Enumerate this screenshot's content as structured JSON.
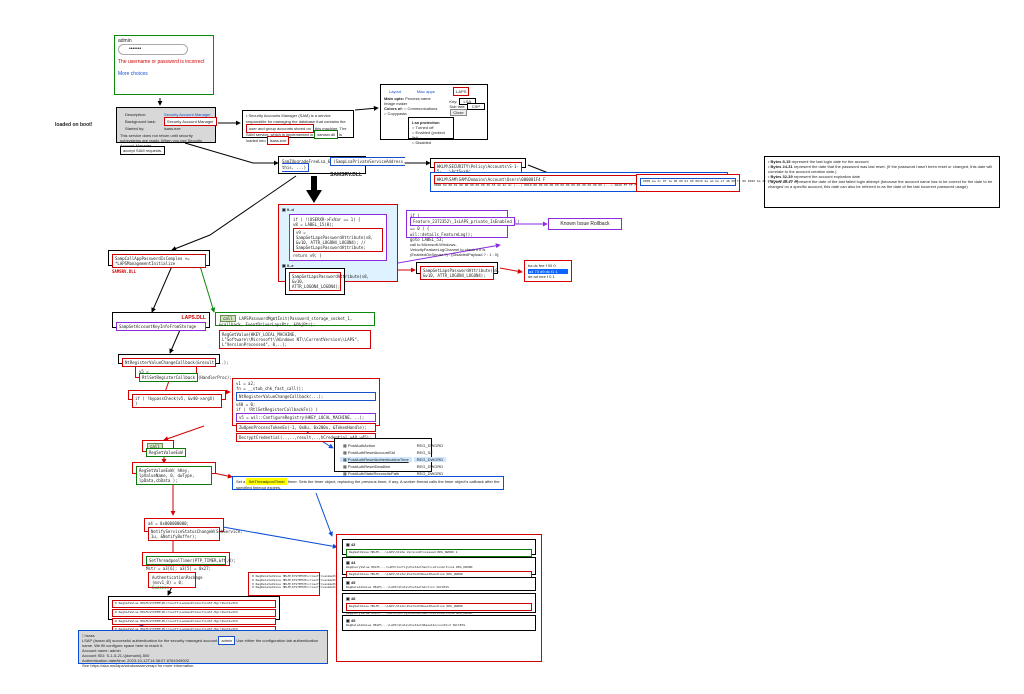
{
  "labels": {
    "loaded_on_boot": "loaded on boot!",
    "samsrv_dll": "SAMSRV.DLL",
    "laps_dll": "LAPS.DLL",
    "kir": "Known Issue Rollback"
  },
  "login": {
    "user": "admin",
    "warn": "The username or password is incorrect",
    "more": "More choices"
  },
  "svc": {
    "k1": "Description:",
    "k2": "Background task:",
    "v2": "Security Account Manager",
    "k3": "Started by:",
    "v3": "lsass.exe"
  },
  "svc_card": {
    "title": "Security Account Manager",
    "body": "This service does not return until security subsystems are ready. When you use Security Account Manager",
    "tail": "interfaces, use this service to ensure the server is ready to",
    "redtail": "accept SAM requests."
  },
  "sam_desc": {
    "a": "Security Accounts Manager (SAM) is a service responsible for managing the database that contains the",
    "b": "user and group accounts stored on",
    "c": " this machine. The SAM service, which is implemented in",
    "d": " is loaded into",
    "e": " at boot time."
  },
  "procexp": {
    "layout": "Layout",
    "misc_apps": "Misc apps",
    "laps": "LAPS",
    "main_opts": "Main opts:",
    "o1": "Process name",
    "o2": "Image maker",
    "colors": "Colors of:",
    "o3": "Communications",
    "o4": "Copypasta",
    "lsasection": "Lsa protection",
    "opt1": "Turned off",
    "opt2": "Enabled (protect list)",
    "opt3": "Disabled",
    "l1": "Key:",
    "v1": "LSA",
    "l2": "Sub tree:",
    "v2": "CSP",
    "close": "Close"
  },
  "samr": {
    "sig": "SamIUpgradeFreeLsa_6",
    "arg": "(SampLsaPrivateServiceAddress, this, ...)",
    "text": "SAMSRV.DLL"
  },
  "sampcalls": {
    "top": "SampCallAppPasswordIsComplex += *LAPSManagementInitialize",
    "bottom": "SampCallAppPasswordIsComplex",
    "next": "SampGetAccountKeyInfoFromStorage"
  },
  "feat": {
    "fn": "Feature_2372352\\_IsLAPS_private_IsEnabled",
    "ret": "() == 0 ) {",
    "l1": "wil::details_FeatureLog();",
    "l2": "goto LABEL_53;",
    "note": "call to Microsoft-Windows-VelocityFeatureLogChannel to check if it is (EnabledOnServer ?) : (DisabledPayload ? : 1 : 0);"
  },
  "codeblock1": {
    "l1": "if ( !(USERXR->FxVar == 1) {",
    "l2": "v8 = LABEL_15(0);",
    "l3": "v9 = SampGetLapsPasswordAttribute(v8, &v10, ATTR_LOGON4_LOGON4); // SampGetLapsPasswordAttribute;",
    "l4": "return v9; }"
  },
  "codeblock2": {
    "fn": "SampGetLapsPasswordAttribute(v8, &v10, ATTR_LOGON4_LOGON4);"
  },
  "laps_init": {
    "call": "LAPSPasswordMgmtInit(Password_storage_socket_1, &callback, EventDriverLapsPtr, &ObjPtr);",
    "reg": "RegGetValue(HKEY_LOCAL_MACHINE, L\"Software\\\\Microsoft\\\\Windows NT\\\\CurrentVersion\\\\LAPS\", L\"VersionProcessed\", 0,..);"
  },
  "bytes": {
    "b1h": "Bytes 8-15",
    "b1t": " represent the last login date for the account",
    "b2h": "Bytes 24-31",
    "b2t": " represent the date that the password was last reset. (If the password hasn't been reset or changed, this date will correlate to the account creation date.)",
    "b3h": "Bytes 32-39",
    "b3t": " represent the account expiration date",
    "b4h": "Bytes 40-47",
    "b4t": " represent the date of the last failed login attempt (because the account name has to be correct for the date to be changed on a specific account, this date can also be referred to as the date of the last incorrect password usage)"
  },
  "hexhdr": "HKLM\\SAM\\SAM\\Domains\\Account\\Users\\000001F4  F",
  "hex": "0000  02 00 01 00 00 00 00 00  30 55 2A 4C 4c (...)\\n0010  00 00 00 00 00 00 00 00  00 00 00 00 00 (...)\\n0020  FF FF FF FF FF FF FF 7F  48 73 D9 DC E0 (...)",
  "hex2": "0000  ba dc 0f fe 00 00 01 00\\n0010  de ad be ef 48 00 f1 00\\n0020  ba dc 0f fe 00 00 f1 00",
  "regpath": "HKLM\\SECURITY\\Policy\\Accounts\\S-1-5-...\\ActSysAc",
  "lapscode": {
    "l0": "v1 = a2;",
    "l1": "fn = __stub_chk_fast_call();",
    "l2": "NtRegisterValueChangeCallback(...);",
    "l3": "v40 = 0;",
    "l4": "if ( !RtlSetRegisterCallbackFn() )",
    "l5": "v5 = wil::ConfigureRegistry(HKEY_LOCAL_MACHINE, ..);",
    "l6": "ZwOpenProcessTokenEx(-1, 0x8u, 0x200u, &TokenHandle);",
    "l7": "DecryptCredential(..,..,result,..,hCredential,v40,v45);",
    "mid": "if ( !bypassCheck(v5, &v40->argX) )"
  },
  "tmr": {
    "a": "Set a",
    "b": "timer.",
    "c": "Sets the timer object, replacing the previous timer, if any. A worker thread calls the timer object's callback after the specified timeout expires."
  },
  "setval": {
    "fn": "RegSetValueExW( hKey, lpValueName, 0, dwType, lpData,cbData );"
  },
  "regtable": {
    "r1n": "PostAuthAction",
    "r1t": "REG_DWORD",
    "r2n": "PostAuthResetAccountSid",
    "r2t": "REG_SZ",
    "r3n": "PostAuthResetAuthenticationTime",
    "r3t": "REG_DWORD",
    "r4n": "PostAuthResetDeadline",
    "r4t": "REG_DWORD",
    "r5n": "PostAuthStateReconcilePath",
    "r5t": "REG_DWORD"
  },
  "notif": {
    "c1": "a4 = 0x800000000;",
    "c2": "NotifyServiceStatusChangeW(SchService, 1u, &NotifyBuffer);"
  },
  "timerthread": {
    "c1": "SetThreadpoolTimer(PTP_TIMER,&ft,0);",
    "c2": "Mstr = a3[6];  a3[5] = 0x27;"
  },
  "authpkg": {
    "l1": "AuthenticationPackage",
    "l2": "(msv1_0) = 0;",
    "l3": "Success"
  },
  "procmon_setA": {
    "r1": "0 RegSetValue HKLM\\SYSTEM\\Microsoft\\LanmanProduct\\LAST-Mgr\\PostAuthX",
    "r2": "0 RegSetValue HKLM\\SYSTEM\\Microsoft\\LanmanProduct\\LAST-Mgr\\PostAuthX",
    "r3": "0 RegSetValue HKLM\\SYSTEM\\Microsoft\\LanmanProduct\\LAST-Mgr\\PostAuthX",
    "r4": "0 RegSetValue HKLM\\SYSTEM\\Microsoft\\LanmanProduct\\LAST-Mgr\\PostAuthX"
  },
  "procmon_setB": {
    "r1": "0 RegDeleteValue HKLM\\SYSTEM\\Microsoft\\LanmanProduct\\LAST-Mgr\\PostAuthX",
    "r2": "0 RegDeleteValue HKLM\\SYSTEM\\Microsoft\\LanmanProduct\\LAST-Mgr\\PostAuthX",
    "r3": "0 RegDeleteValue HKLM\\SYSTEM\\Microsoft\\LanmanProduct\\LAST-Mgr\\PostAuthX",
    "r4": "0 RegDeleteValue HKLM\\SYSTEM\\Microsoft\\LanmanProduct\\LAST-Mgr\\PostAuthX"
  },
  "wevt": {
    "nA": "43",
    "nB": "44",
    "nC": "45",
    "nD": "48",
    "nE": "49"
  },
  "lsap": {
    "c": "lsass",
    "t": "LSAP (lsasrv.dll) successful authentication for the security managed account",
    "mid": " Use either the configuration tab authentication name. We fill configure space here to reach it.",
    "acc": "Account name: admin",
    "sid": "Account SID: S-1-5-21-\\{domain\\}-500",
    "auth": "Authentication date/time: 2023-10-12T14:36:07.876434900Z",
    "more": "See https://aka.ms/laps/windowsserverapi for more information."
  },
  "pm_details": {
    "r1": "RegSetValue  HKLM\\...\\LAPS\\State  VersionProcessed  REG_DWORD 1",
    "r2": "RegQueryValue HKLM\\...\\LAPS\\Config\\PostAuthenticationActions  REG_DWORD",
    "r3": "RegSetValue  HKLM\\...\\LAPS\\State\\PostAuthResetDeadline  REG_QWORD",
    "r4": "RegDeleteValue HKLM\\...\\LAPS\\State\\PostAuthAction  SUCCESS",
    "r5": "RegDeleteValue HKLM\\...\\LAPS\\State\\PostAuthResetAccountSid  SUCCESS"
  }
}
